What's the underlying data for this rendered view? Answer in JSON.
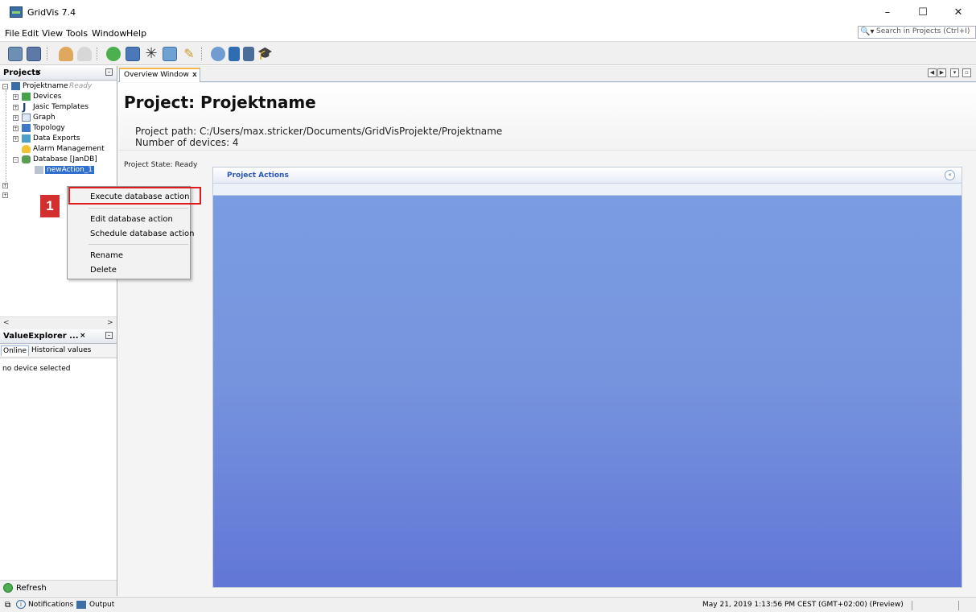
{
  "window": {
    "title": "GridVis 7.4",
    "minimize": "–",
    "maximize": "☐",
    "close": "✕"
  },
  "menu": {
    "items": [
      "File",
      "Edit",
      "View",
      "Tools",
      "Window",
      "Help"
    ]
  },
  "search": {
    "placeholder": "Search in Projects (Ctrl+I)",
    "icon": "search-icon"
  },
  "projects_panel": {
    "title": "Projects",
    "close": "×",
    "root": {
      "label": "Projektname",
      "status": "Ready"
    },
    "items": [
      {
        "label": "Devices",
        "icon": "devices-icon"
      },
      {
        "label": "Jasic Templates",
        "icon": "jasic-icon"
      },
      {
        "label": "Graph",
        "icon": "graph-icon"
      },
      {
        "label": "Topology",
        "icon": "topology-icon"
      },
      {
        "label": "Data Exports",
        "icon": "data-export-icon"
      },
      {
        "label": "Alarm Management",
        "icon": "alarm-icon"
      },
      {
        "label": "Database [JanDB]",
        "icon": "database-icon"
      },
      {
        "label": "newAction_1",
        "icon": "action-icon"
      }
    ]
  },
  "value_explorer": {
    "title": "ValueExplorer ...",
    "close": "×",
    "tabs": [
      "Online",
      "Historical values"
    ],
    "content": "no device selected"
  },
  "refresh": {
    "label": "Refresh"
  },
  "statusbar": {
    "notifications": "Notifications",
    "output": "Output",
    "datetime": "May 21, 2019 1:13:56 PM CEST (GMT+02:00)  (Preview)"
  },
  "editor": {
    "tab": {
      "label": "Overview Window",
      "close": "x"
    },
    "nav": {
      "prev": "◀",
      "next": "▶",
      "list": "▾",
      "restore": "▫"
    },
    "title": "Project: Projektname",
    "path": "Project path: C:/Users/max.stricker/Documents/GridVisProjekte/Projektname",
    "devices": "Number of devices: 4",
    "state": "Project State: Ready",
    "actions": {
      "title": "Project Actions",
      "collapse": "«"
    }
  },
  "context_menu": {
    "items": {
      "execute": "Execute database action",
      "edit": "Edit database action",
      "schedule": "Schedule database action",
      "rename": "Rename",
      "delete": "Delete"
    }
  },
  "annotation": {
    "step": "1"
  },
  "colors": {
    "accent_tab": "#f5b64b",
    "actions_gradient_top": "#7b9de2",
    "actions_gradient_bottom": "#6277d6",
    "highlight": "#e01b1b",
    "badge": "#d32f2f"
  }
}
